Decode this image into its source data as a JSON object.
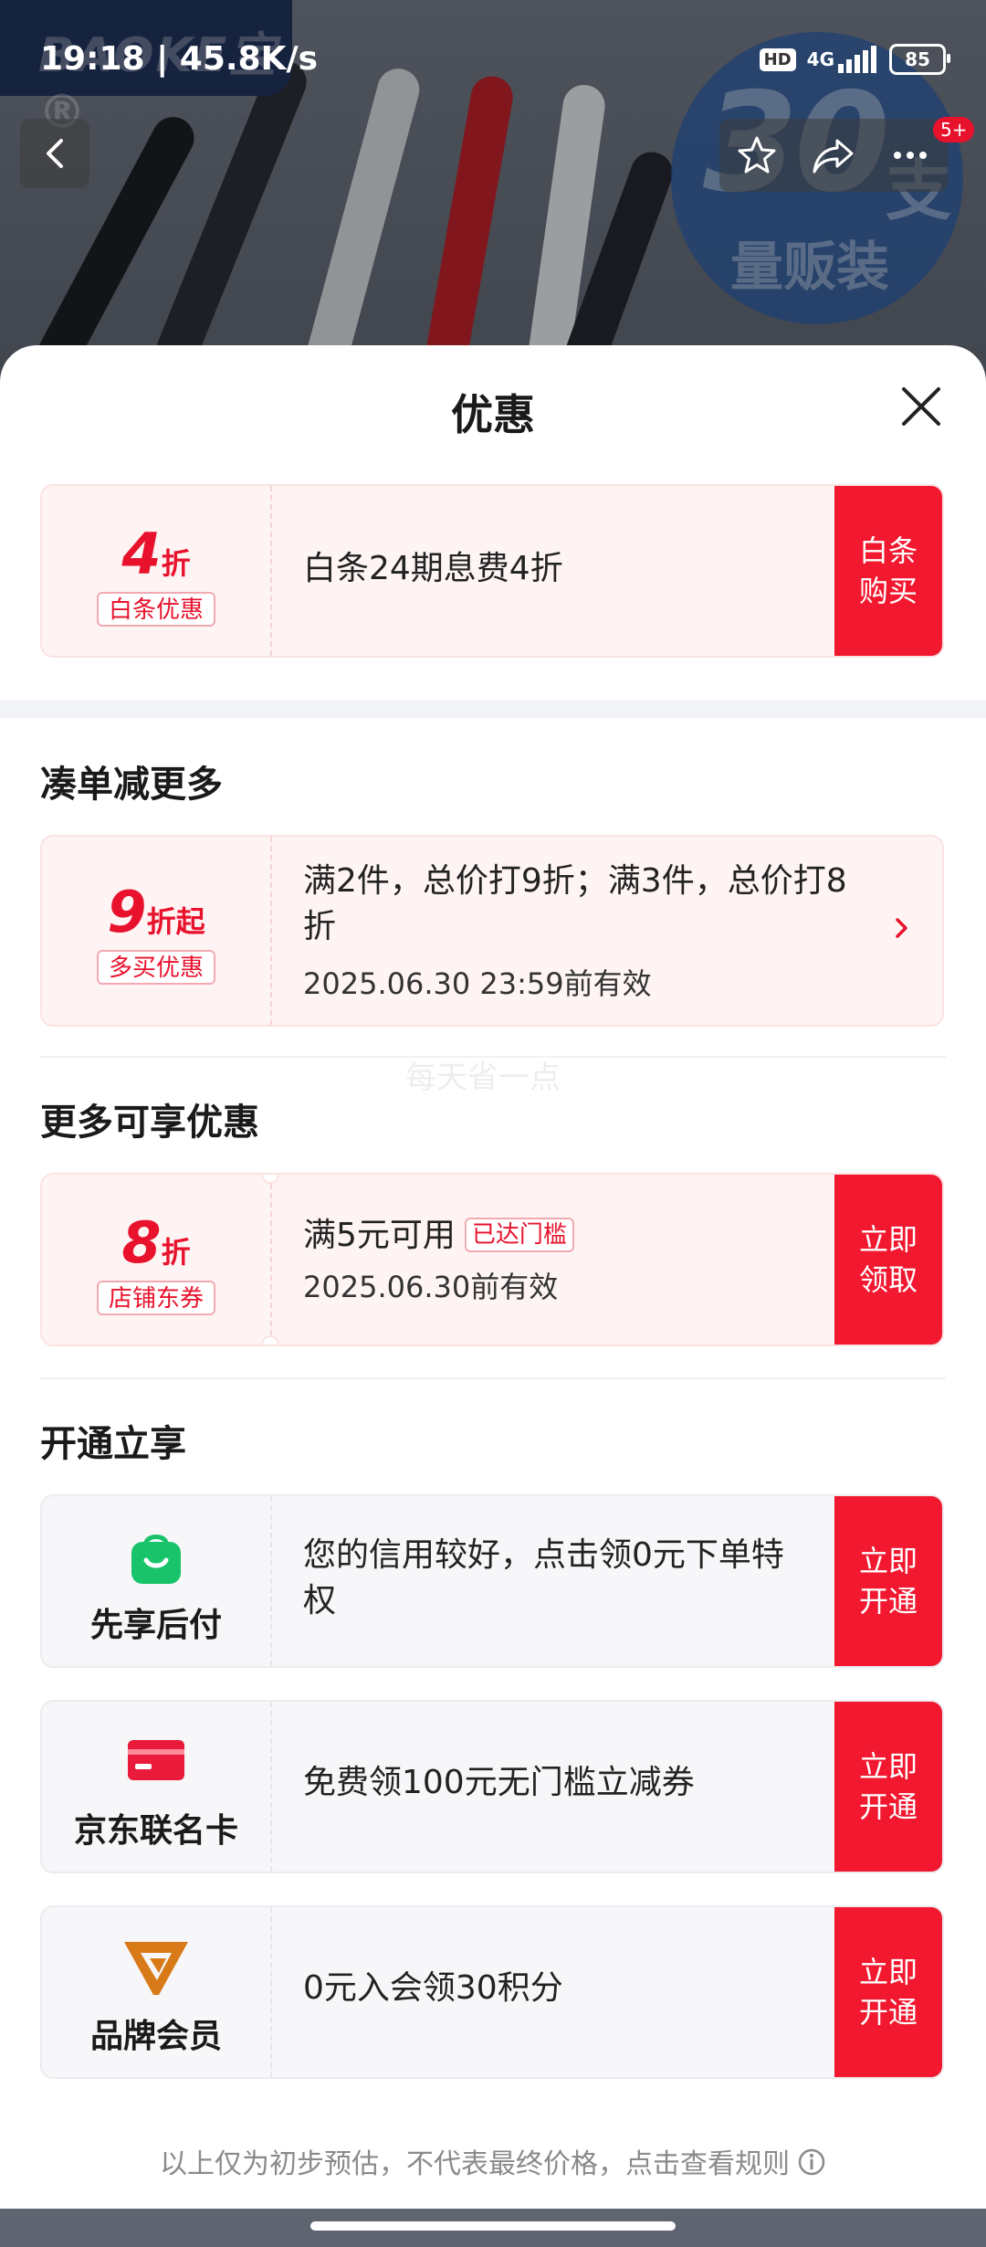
{
  "status_bar": {
    "time_speed": "19:18 | 45.8K/s",
    "hd": "HD",
    "network": "4G",
    "battery": "85"
  },
  "background": {
    "brand_watermark": "BAOKE宝®",
    "promo_number": "30",
    "promo_unit": "支",
    "promo_text": "量贩装",
    "action_badge": "5+"
  },
  "sheet": {
    "title": "优惠",
    "watermark": "每天省一点",
    "footer_note": "以上仅为初步预估，不代表最终价格，点击查看规则"
  },
  "baitiao": {
    "discount_num": "4",
    "discount_unit": "折",
    "tag": "白条优惠",
    "text": "白条24期息费4折",
    "button": "白条\n购买"
  },
  "section_combine": {
    "title": "凑单减更多",
    "discount_num": "9",
    "discount_unit": "折起",
    "tag": "多买优惠",
    "text": "满2件，总价打9折；满3件，总价打8折",
    "validity": "2025.06.30 23:59前有效"
  },
  "section_more": {
    "title": "更多可享优惠",
    "discount_num": "8",
    "discount_unit": "折",
    "tag": "店铺东券",
    "text": "满5元可用",
    "reached": "已达门槛",
    "validity": "2025.06.30前有效",
    "button": "立即\n领取"
  },
  "section_open": {
    "title": "开通立享",
    "items": [
      {
        "icon": "shopping-bag-icon",
        "label": "先享后付",
        "text": "您的信用较好，点击领0元下单特权",
        "button": "立即\n开通"
      },
      {
        "icon": "credit-card-icon",
        "label": "京东联名卡",
        "text": "免费领100元无门槛立减券",
        "button": "立即\n开通"
      },
      {
        "icon": "brand-v-icon",
        "label": "品牌会员",
        "text": "0元入会领30积分",
        "button": "立即\n开通"
      }
    ]
  },
  "colors": {
    "accent_red": "#f2182f",
    "discount_red": "#e8122d",
    "bag_green": "#19c36a",
    "card_red": "#ea1b3a",
    "brand_orange": "#d97a18"
  }
}
